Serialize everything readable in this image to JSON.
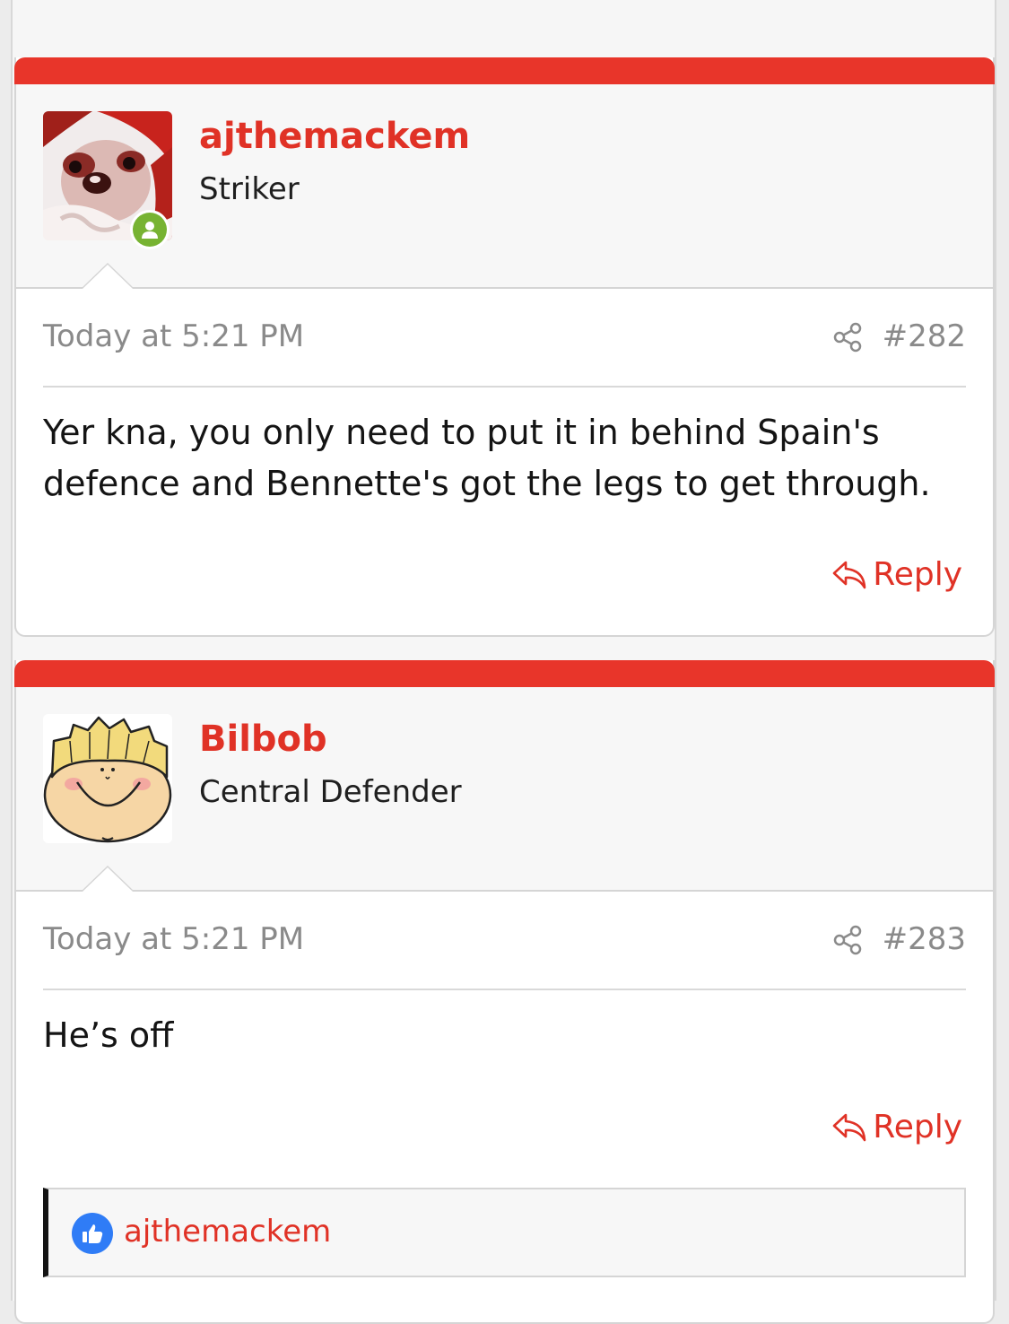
{
  "posts": [
    {
      "username": "ajthemackem",
      "user_title": "Striker",
      "avatar": "chihuahua-santa-hat-avatar",
      "online": true,
      "timestamp": "Today at 5:21 PM",
      "post_number": "#282",
      "message": "Yer kna, you only need to put it in behind Spain's defence and Bennette's got the legs to get through.",
      "reply_label": "Reply"
    },
    {
      "username": "Bilbob",
      "user_title": "Central Defender",
      "avatar": "cartoon-face-avatar",
      "online": false,
      "timestamp": "Today at 5:21 PM",
      "post_number": "#283",
      "message": "He’s off",
      "reply_label": "Reply",
      "reactions": {
        "icon": "like-icon",
        "users": "ajthemackem"
      }
    }
  ],
  "colors": {
    "accent": "#e8352a",
    "link": "#e03226",
    "online": "#77b332",
    "like": "#2f7cf6"
  }
}
